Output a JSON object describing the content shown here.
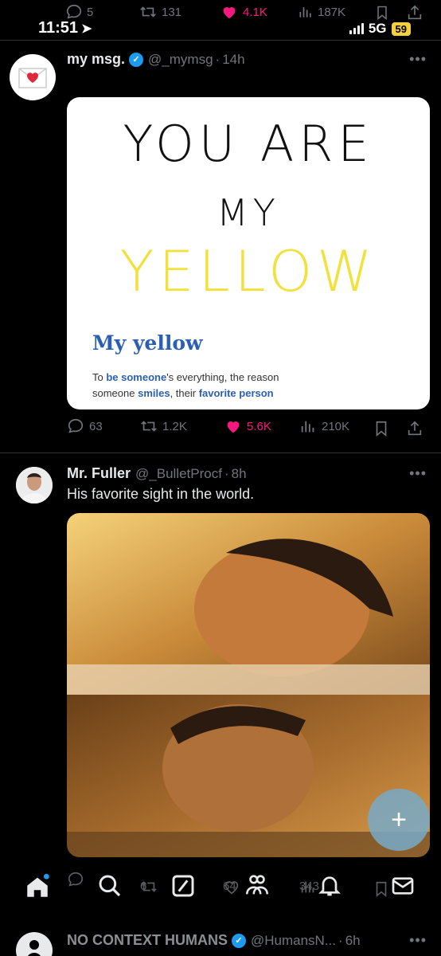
{
  "status_bar": {
    "time": "11:51",
    "network": "5G",
    "battery": "59"
  },
  "prev_tweet_actions": {
    "replies": "5",
    "retweets": "131",
    "likes": "4.1K",
    "views": "187K"
  },
  "tweet1": {
    "display_name": "my msg.",
    "handle": "@_mymsg",
    "time": "14h",
    "image": {
      "line1": "YOU ARE",
      "line2": "MY",
      "line3": "YELLOW",
      "dict_title": "My yellow",
      "def_p1": "To ",
      "def_b1": "be someone",
      "def_p2": "'s everything, the reason",
      "def_p3": "someone ",
      "def_b2": "smiles",
      "def_p4": ", their ",
      "def_b3": "favorite person"
    },
    "replies": "63",
    "retweets": "1.2K",
    "likes": "5.6K",
    "views": "210K"
  },
  "tweet2": {
    "display_name": "Mr. Fuller",
    "handle": "@_BulletProcf",
    "time": "8h",
    "text": "His favorite sight in the world.",
    "replies": "",
    "retweets": "6",
    "likes": "64",
    "views": "343"
  },
  "tweet3": {
    "display_name": "NO CONTEXT HUMANS",
    "handle": "@HumansN...",
    "time": "6h"
  },
  "colors": {
    "like": "#f91880",
    "accent": "#1d9bf0",
    "muted": "#71767b"
  }
}
